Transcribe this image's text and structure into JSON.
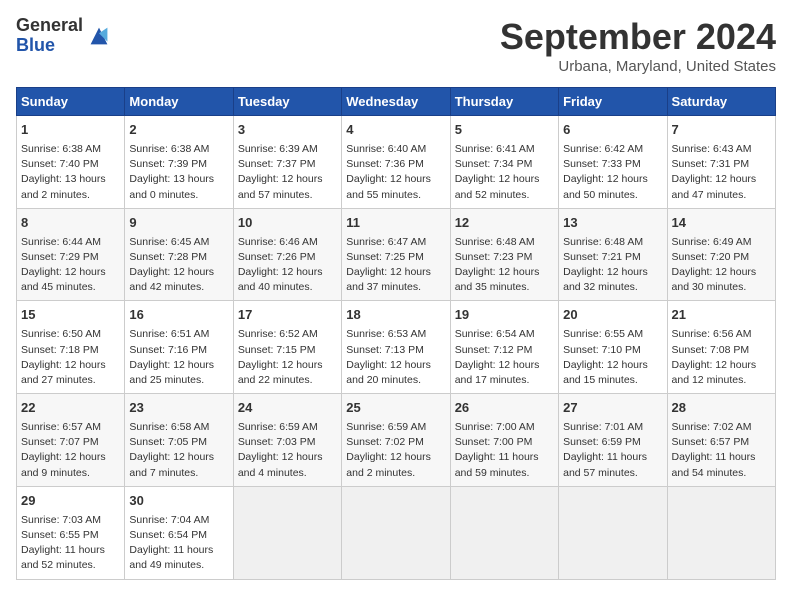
{
  "header": {
    "logo_line1": "General",
    "logo_line2": "Blue",
    "month": "September 2024",
    "location": "Urbana, Maryland, United States"
  },
  "days_of_week": [
    "Sunday",
    "Monday",
    "Tuesday",
    "Wednesday",
    "Thursday",
    "Friday",
    "Saturday"
  ],
  "weeks": [
    [
      {
        "day": 1,
        "lines": [
          "Sunrise: 6:38 AM",
          "Sunset: 7:40 PM",
          "Daylight: 13 hours",
          "and 2 minutes."
        ]
      },
      {
        "day": 2,
        "lines": [
          "Sunrise: 6:38 AM",
          "Sunset: 7:39 PM",
          "Daylight: 13 hours",
          "and 0 minutes."
        ]
      },
      {
        "day": 3,
        "lines": [
          "Sunrise: 6:39 AM",
          "Sunset: 7:37 PM",
          "Daylight: 12 hours",
          "and 57 minutes."
        ]
      },
      {
        "day": 4,
        "lines": [
          "Sunrise: 6:40 AM",
          "Sunset: 7:36 PM",
          "Daylight: 12 hours",
          "and 55 minutes."
        ]
      },
      {
        "day": 5,
        "lines": [
          "Sunrise: 6:41 AM",
          "Sunset: 7:34 PM",
          "Daylight: 12 hours",
          "and 52 minutes."
        ]
      },
      {
        "day": 6,
        "lines": [
          "Sunrise: 6:42 AM",
          "Sunset: 7:33 PM",
          "Daylight: 12 hours",
          "and 50 minutes."
        ]
      },
      {
        "day": 7,
        "lines": [
          "Sunrise: 6:43 AM",
          "Sunset: 7:31 PM",
          "Daylight: 12 hours",
          "and 47 minutes."
        ]
      }
    ],
    [
      {
        "day": 8,
        "lines": [
          "Sunrise: 6:44 AM",
          "Sunset: 7:29 PM",
          "Daylight: 12 hours",
          "and 45 minutes."
        ]
      },
      {
        "day": 9,
        "lines": [
          "Sunrise: 6:45 AM",
          "Sunset: 7:28 PM",
          "Daylight: 12 hours",
          "and 42 minutes."
        ]
      },
      {
        "day": 10,
        "lines": [
          "Sunrise: 6:46 AM",
          "Sunset: 7:26 PM",
          "Daylight: 12 hours",
          "and 40 minutes."
        ]
      },
      {
        "day": 11,
        "lines": [
          "Sunrise: 6:47 AM",
          "Sunset: 7:25 PM",
          "Daylight: 12 hours",
          "and 37 minutes."
        ]
      },
      {
        "day": 12,
        "lines": [
          "Sunrise: 6:48 AM",
          "Sunset: 7:23 PM",
          "Daylight: 12 hours",
          "and 35 minutes."
        ]
      },
      {
        "day": 13,
        "lines": [
          "Sunrise: 6:48 AM",
          "Sunset: 7:21 PM",
          "Daylight: 12 hours",
          "and 32 minutes."
        ]
      },
      {
        "day": 14,
        "lines": [
          "Sunrise: 6:49 AM",
          "Sunset: 7:20 PM",
          "Daylight: 12 hours",
          "and 30 minutes."
        ]
      }
    ],
    [
      {
        "day": 15,
        "lines": [
          "Sunrise: 6:50 AM",
          "Sunset: 7:18 PM",
          "Daylight: 12 hours",
          "and 27 minutes."
        ]
      },
      {
        "day": 16,
        "lines": [
          "Sunrise: 6:51 AM",
          "Sunset: 7:16 PM",
          "Daylight: 12 hours",
          "and 25 minutes."
        ]
      },
      {
        "day": 17,
        "lines": [
          "Sunrise: 6:52 AM",
          "Sunset: 7:15 PM",
          "Daylight: 12 hours",
          "and 22 minutes."
        ]
      },
      {
        "day": 18,
        "lines": [
          "Sunrise: 6:53 AM",
          "Sunset: 7:13 PM",
          "Daylight: 12 hours",
          "and 20 minutes."
        ]
      },
      {
        "day": 19,
        "lines": [
          "Sunrise: 6:54 AM",
          "Sunset: 7:12 PM",
          "Daylight: 12 hours",
          "and 17 minutes."
        ]
      },
      {
        "day": 20,
        "lines": [
          "Sunrise: 6:55 AM",
          "Sunset: 7:10 PM",
          "Daylight: 12 hours",
          "and 15 minutes."
        ]
      },
      {
        "day": 21,
        "lines": [
          "Sunrise: 6:56 AM",
          "Sunset: 7:08 PM",
          "Daylight: 12 hours",
          "and 12 minutes."
        ]
      }
    ],
    [
      {
        "day": 22,
        "lines": [
          "Sunrise: 6:57 AM",
          "Sunset: 7:07 PM",
          "Daylight: 12 hours",
          "and 9 minutes."
        ]
      },
      {
        "day": 23,
        "lines": [
          "Sunrise: 6:58 AM",
          "Sunset: 7:05 PM",
          "Daylight: 12 hours",
          "and 7 minutes."
        ]
      },
      {
        "day": 24,
        "lines": [
          "Sunrise: 6:59 AM",
          "Sunset: 7:03 PM",
          "Daylight: 12 hours",
          "and 4 minutes."
        ]
      },
      {
        "day": 25,
        "lines": [
          "Sunrise: 6:59 AM",
          "Sunset: 7:02 PM",
          "Daylight: 12 hours",
          "and 2 minutes."
        ]
      },
      {
        "day": 26,
        "lines": [
          "Sunrise: 7:00 AM",
          "Sunset: 7:00 PM",
          "Daylight: 11 hours",
          "and 59 minutes."
        ]
      },
      {
        "day": 27,
        "lines": [
          "Sunrise: 7:01 AM",
          "Sunset: 6:59 PM",
          "Daylight: 11 hours",
          "and 57 minutes."
        ]
      },
      {
        "day": 28,
        "lines": [
          "Sunrise: 7:02 AM",
          "Sunset: 6:57 PM",
          "Daylight: 11 hours",
          "and 54 minutes."
        ]
      }
    ],
    [
      {
        "day": 29,
        "lines": [
          "Sunrise: 7:03 AM",
          "Sunset: 6:55 PM",
          "Daylight: 11 hours",
          "and 52 minutes."
        ]
      },
      {
        "day": 30,
        "lines": [
          "Sunrise: 7:04 AM",
          "Sunset: 6:54 PM",
          "Daylight: 11 hours",
          "and 49 minutes."
        ]
      },
      {
        "day": null,
        "lines": []
      },
      {
        "day": null,
        "lines": []
      },
      {
        "day": null,
        "lines": []
      },
      {
        "day": null,
        "lines": []
      },
      {
        "day": null,
        "lines": []
      }
    ]
  ]
}
